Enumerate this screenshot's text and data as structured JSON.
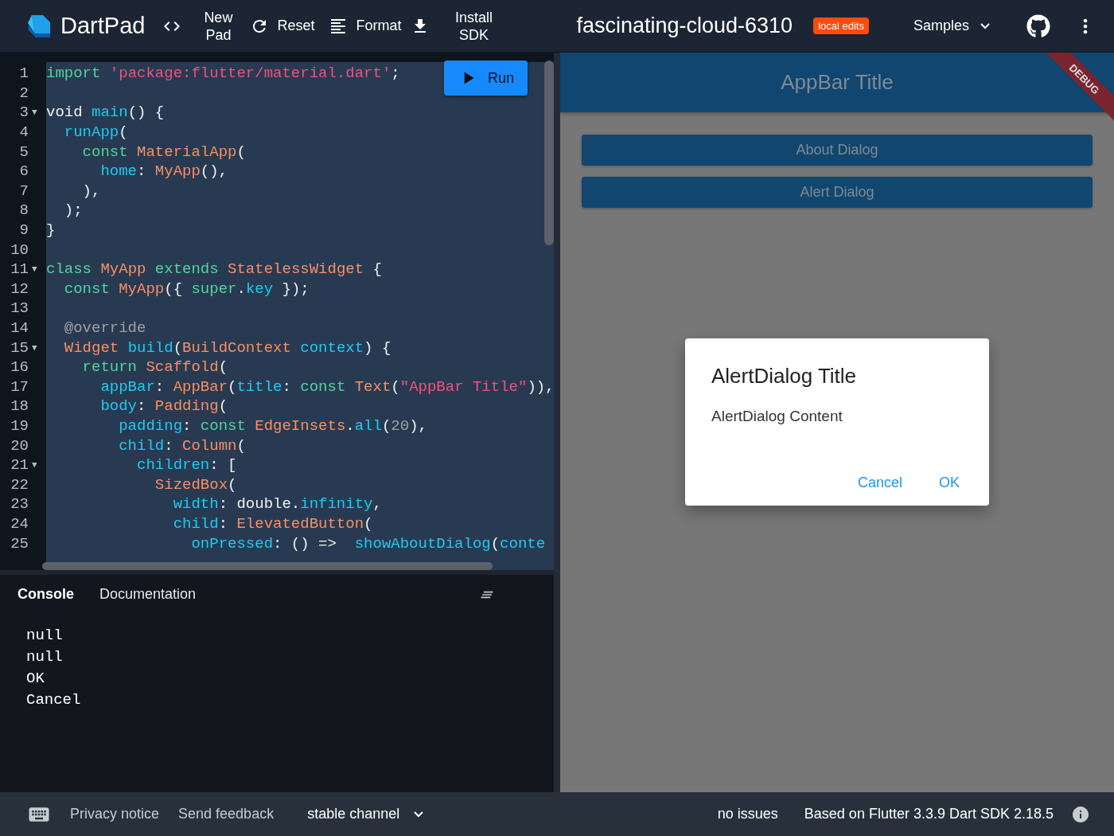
{
  "header": {
    "app_name": "DartPad",
    "actions": [
      {
        "label": "New Pad"
      },
      {
        "label": "Reset"
      },
      {
        "label": "Format"
      },
      {
        "label": "Install SDK"
      }
    ],
    "title": "fascinating-cloud-6310",
    "badge": "local edits",
    "samples": "Samples"
  },
  "editor": {
    "run_label": "Run",
    "lines": [
      {
        "number": "1",
        "tokens": [
          {
            "text": "import ",
            "kind": "keyword"
          },
          {
            "text": "'package:flutter/material.dart'",
            "kind": "string"
          },
          {
            "text": ";",
            "kind": "plain"
          }
        ]
      },
      {
        "number": "2"
      },
      {
        "number": "3",
        "fold": "▼",
        "tokens": [
          {
            "text": "void ",
            "kind": "plain"
          },
          {
            "text": "main",
            "kind": "function"
          },
          {
            "text": "() {",
            "kind": "plain"
          }
        ]
      },
      {
        "number": "4",
        "tokens": [
          {
            "text": "  runApp",
            "kind": "function"
          },
          {
            "text": "(",
            "kind": "plain"
          }
        ]
      },
      {
        "number": "5",
        "tokens": [
          {
            "text": "    const ",
            "kind": "keyword"
          },
          {
            "text": "MaterialApp",
            "kind": "class"
          },
          {
            "text": "(",
            "kind": "plain"
          }
        ]
      },
      {
        "number": "6",
        "tokens": [
          {
            "text": "      home",
            "kind": "function"
          },
          {
            "text": ": ",
            "kind": "plain"
          },
          {
            "text": "MyApp",
            "kind": "class"
          },
          {
            "text": "(),",
            "kind": "plain"
          }
        ]
      },
      {
        "number": "7",
        "tokens": [
          {
            "text": "    ),",
            "kind": "plain"
          }
        ]
      },
      {
        "number": "8",
        "tokens": [
          {
            "text": "  );",
            "kind": "plain"
          }
        ]
      },
      {
        "number": "9",
        "tokens": [
          {
            "text": "}",
            "kind": "plain"
          }
        ]
      },
      {
        "number": "10"
      },
      {
        "number": "11",
        "fold": "▼",
        "tokens": [
          {
            "text": "class ",
            "kind": "keyword"
          },
          {
            "text": "MyApp ",
            "kind": "class"
          },
          {
            "text": "extends ",
            "kind": "keyword"
          },
          {
            "text": "StatelessWidget ",
            "kind": "class"
          },
          {
            "text": "{",
            "kind": "plain"
          }
        ]
      },
      {
        "number": "12",
        "tokens": [
          {
            "text": "  const ",
            "kind": "keyword"
          },
          {
            "text": "MyApp",
            "kind": "class"
          },
          {
            "text": "({ ",
            "kind": "plain"
          },
          {
            "text": "super",
            "kind": "keyword"
          },
          {
            "text": ".",
            "kind": "plain"
          },
          {
            "text": "key",
            "kind": "function"
          },
          {
            "text": " });",
            "kind": "plain"
          }
        ]
      },
      {
        "number": "13"
      },
      {
        "number": "14",
        "tokens": [
          {
            "text": "  @override",
            "kind": "meta"
          }
        ]
      },
      {
        "number": "15",
        "fold": "▼",
        "tokens": [
          {
            "text": "  Widget ",
            "kind": "class"
          },
          {
            "text": "build",
            "kind": "function"
          },
          {
            "text": "(",
            "kind": "plain"
          },
          {
            "text": "BuildContext ",
            "kind": "class"
          },
          {
            "text": "context",
            "kind": "function"
          },
          {
            "text": ") {",
            "kind": "plain"
          }
        ]
      },
      {
        "number": "16",
        "tokens": [
          {
            "text": "    return ",
            "kind": "keyword"
          },
          {
            "text": "Scaffold",
            "kind": "class"
          },
          {
            "text": "(",
            "kind": "plain"
          }
        ]
      },
      {
        "number": "17",
        "tokens": [
          {
            "text": "      appBar",
            "kind": "function"
          },
          {
            "text": ": ",
            "kind": "plain"
          },
          {
            "text": "AppBar",
            "kind": "class"
          },
          {
            "text": "(",
            "kind": "plain"
          },
          {
            "text": "title",
            "kind": "function"
          },
          {
            "text": ": ",
            "kind": "plain"
          },
          {
            "text": "const ",
            "kind": "keyword"
          },
          {
            "text": "Text",
            "kind": "class"
          },
          {
            "text": "(",
            "kind": "plain"
          },
          {
            "text": "\"AppBar Title\"",
            "kind": "string"
          },
          {
            "text": ")),",
            "kind": "plain"
          }
        ]
      },
      {
        "number": "18",
        "tokens": [
          {
            "text": "      body",
            "kind": "function"
          },
          {
            "text": ": ",
            "kind": "plain"
          },
          {
            "text": "Padding",
            "kind": "class"
          },
          {
            "text": "(",
            "kind": "plain"
          }
        ]
      },
      {
        "number": "19",
        "tokens": [
          {
            "text": "        padding",
            "kind": "function"
          },
          {
            "text": ": ",
            "kind": "plain"
          },
          {
            "text": "const ",
            "kind": "keyword"
          },
          {
            "text": "EdgeInsets",
            "kind": "class"
          },
          {
            "text": ".",
            "kind": "plain"
          },
          {
            "text": "all",
            "kind": "function"
          },
          {
            "text": "(",
            "kind": "plain"
          },
          {
            "text": "20",
            "kind": "number"
          },
          {
            "text": "),",
            "kind": "plain"
          }
        ]
      },
      {
        "number": "20",
        "tokens": [
          {
            "text": "        child",
            "kind": "function"
          },
          {
            "text": ": ",
            "kind": "plain"
          },
          {
            "text": "Column",
            "kind": "class"
          },
          {
            "text": "(",
            "kind": "plain"
          }
        ]
      },
      {
        "number": "21",
        "fold": "▼",
        "tokens": [
          {
            "text": "          children",
            "kind": "function"
          },
          {
            "text": ": [",
            "kind": "plain"
          }
        ]
      },
      {
        "number": "22",
        "tokens": [
          {
            "text": "            SizedBox",
            "kind": "class"
          },
          {
            "text": "(",
            "kind": "plain"
          }
        ]
      },
      {
        "number": "23",
        "tokens": [
          {
            "text": "              width",
            "kind": "function"
          },
          {
            "text": ": double.",
            "kind": "plain"
          },
          {
            "text": "infinity",
            "kind": "function"
          },
          {
            "text": ",",
            "kind": "plain"
          }
        ]
      },
      {
        "number": "24",
        "tokens": [
          {
            "text": "              child",
            "kind": "function"
          },
          {
            "text": ": ",
            "kind": "plain"
          },
          {
            "text": "ElevatedButton",
            "kind": "class"
          },
          {
            "text": "(",
            "kind": "plain"
          }
        ]
      },
      {
        "number": "25",
        "tokens": [
          {
            "text": "                onPressed",
            "kind": "function"
          },
          {
            "text": ": () =>  ",
            "kind": "plain"
          },
          {
            "text": "showAboutDialog",
            "kind": "function"
          },
          {
            "text": "(",
            "kind": "plain"
          },
          {
            "text": "conte",
            "kind": "function"
          }
        ]
      }
    ]
  },
  "console": {
    "tabs": [
      {
        "label": "Console",
        "selected": true
      },
      {
        "label": "Documentation",
        "selected": false
      }
    ],
    "output": [
      "null",
      "null",
      "OK",
      "Cancel"
    ]
  },
  "preview": {
    "appbar_title": "AppBar Title",
    "debug_banner": "DEBUG",
    "buttons": [
      "About Dialog",
      "Alert Dialog"
    ],
    "dialog": {
      "title": "AlertDialog Title",
      "content": "AlertDialog Content",
      "actions": [
        "Cancel",
        "OK"
      ]
    }
  },
  "status_bar": {
    "links": [
      "Privacy notice",
      "Send feedback"
    ],
    "channel": "stable channel",
    "issues": "no issues",
    "version": "Based on Flutter 3.3.9 Dart SDK 2.18.5"
  }
}
